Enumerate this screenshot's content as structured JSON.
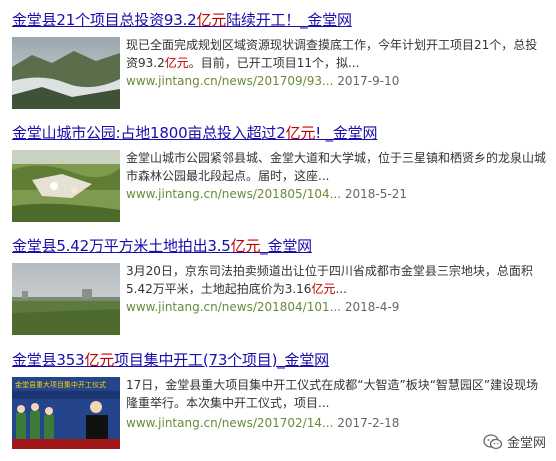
{
  "results": [
    {
      "title_pre": "金堂县21个项目总投资93.2",
      "title_hl": "亿元",
      "title_post": "陆续开工！_金堂网",
      "snippet_pre": "现已全面完成规划区域资源现状调查摸底工作，今年计划开工项目21个，总投资93.2",
      "snippet_hl": "亿元",
      "snippet_post": "。目前，已开工项目11个，拟...",
      "url": "www.jintang.cn/news/201709/93...",
      "date": "2017-9-10"
    },
    {
      "title_pre": "金堂山城市公园:占地1800亩总投入超过2",
      "title_hl": "亿元",
      "title_post": "! _金堂网",
      "snippet_pre": "金堂山城市公园紧邻县城、金堂大道和大学城，位于三星镇和栖贤乡的龙泉山城市森林公园最北段起点。届时，这座...",
      "snippet_hl": "",
      "snippet_post": "",
      "url": "www.jintang.cn/news/201805/104...",
      "date": "2018-5-21"
    },
    {
      "title_pre": "金堂县5.42万平方米土地拍出3.5",
      "title_hl": "亿元",
      "title_post": "_金堂网",
      "snippet_pre": "3月20日，京东司法拍卖频道出让位于四川省成都市金堂县三宗地块，总面积5.42万平米，土地起拍底价为3.16",
      "snippet_hl": "亿元",
      "snippet_post": "...",
      "url": "www.jintang.cn/news/201804/101...",
      "date": "2018-4-9"
    },
    {
      "title_pre": "金堂县353",
      "title_hl": "亿元",
      "title_post": "项目集中开工(73个项目)_金堂网",
      "snippet_pre": "17日，金堂县重大项目集中开工仪式在成都“大智造”板块“智慧园区”建设现场隆重举行。本次集中开工仪式，项目...",
      "snippet_hl": "",
      "snippet_post": "",
      "url": "www.jintang.cn/news/201702/14...",
      "date": "2017-2-18",
      "thumb_text": "金堂县重大项目集中开工仪式"
    }
  ],
  "watermark": {
    "text": "金堂网",
    "icon": "wechat-icon"
  }
}
